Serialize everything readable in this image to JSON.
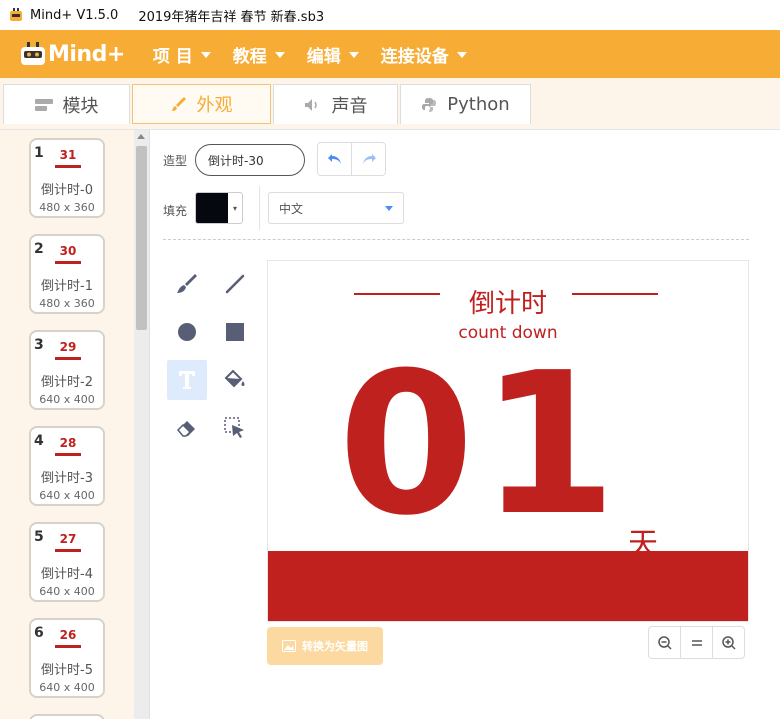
{
  "window": {
    "app": "Mind+ V1.5.0",
    "file": "2019年猪年吉祥 春节 新春.sb3"
  },
  "menubar": {
    "logo_text": "Mind+",
    "items": [
      {
        "label": "项 目"
      },
      {
        "label": "教程"
      },
      {
        "label": "编辑"
      },
      {
        "label": "连接设备"
      }
    ]
  },
  "tabs": [
    {
      "label": "模块",
      "icon": "blocks-icon"
    },
    {
      "label": "外观",
      "icon": "brush-icon"
    },
    {
      "label": "声音",
      "icon": "speaker-icon"
    },
    {
      "label": "Python",
      "icon": "python-icon"
    }
  ],
  "costumes": [
    {
      "number": "1",
      "thumb": "31",
      "name": "倒计时-0",
      "size": "480 x 360"
    },
    {
      "number": "2",
      "thumb": "30",
      "name": "倒计时-1",
      "size": "480 x 360"
    },
    {
      "number": "3",
      "thumb": "29",
      "name": "倒计时-2",
      "size": "640 x 400"
    },
    {
      "number": "4",
      "thumb": "28",
      "name": "倒计时-3",
      "size": "640 x 400"
    },
    {
      "number": "5",
      "thumb": "27",
      "name": "倒计时-4",
      "size": "640 x 400"
    },
    {
      "number": "6",
      "thumb": "26",
      "name": "倒计时-5",
      "size": "640 x 400"
    }
  ],
  "editor": {
    "costume_label": "造型",
    "costume_name": "倒计时-30",
    "fill_label": "填充",
    "fill_color": "#06080f",
    "language": "中文",
    "convert_label": "转换为矢量图"
  },
  "canvas": {
    "title": "倒计时",
    "subtitle": "count down",
    "digits": "01",
    "unit": "天",
    "accent": "#c0201e"
  }
}
